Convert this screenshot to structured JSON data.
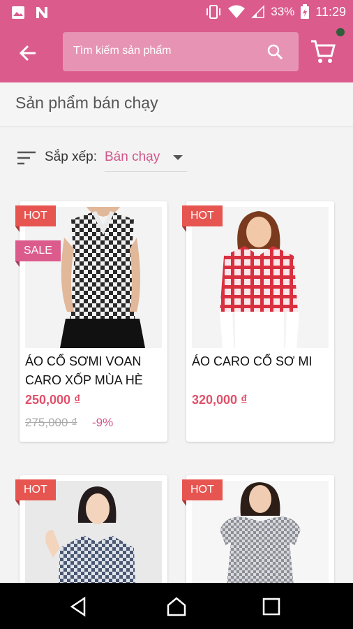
{
  "status_bar": {
    "battery": "33%",
    "time": "11:29"
  },
  "app_bar": {
    "search_placeholder": "Tìm kiếm sản phẩm",
    "accent_color": "#db5b8c"
  },
  "page": {
    "title": "Sản phẩm bán chạy"
  },
  "sort": {
    "label": "Sắp xếp:",
    "value": "Bán chạy"
  },
  "products": [
    {
      "badges": [
        "HOT",
        "SALE"
      ],
      "name": "ÁO CỔ SƠMI VOAN CARO XỐP MÙA HÈ",
      "price": "250,000 ₫",
      "old_price": "275,000 ₫",
      "discount": "-9%"
    },
    {
      "badges": [
        "HOT"
      ],
      "name": "ÁO CARO CỔ SƠ MI",
      "price": "320,000 ₫"
    },
    {
      "badges": [
        "HOT"
      ]
    },
    {
      "badges": [
        "HOT"
      ]
    }
  ]
}
